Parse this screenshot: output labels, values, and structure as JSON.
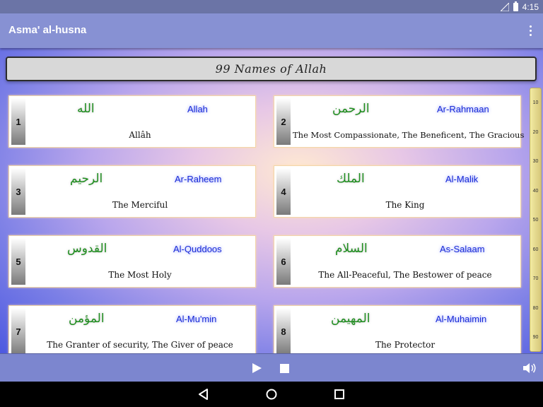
{
  "status_bar": {
    "time": "4:15",
    "icons": [
      "signal-icon",
      "battery-icon"
    ]
  },
  "app_bar": {
    "title": "Asma' al-husna",
    "menu_icon": "overflow-menu-icon"
  },
  "header": {
    "title": "99 Names of Allah"
  },
  "names": [
    {
      "number": "1",
      "arabic": "الله",
      "transliteration": "Allah",
      "meaning": "Allâh"
    },
    {
      "number": "2",
      "arabic": "الرحمن",
      "transliteration": "Ar-Rahmaan",
      "meaning": "The Most Compassionate, The Beneficent, The Gracious"
    },
    {
      "number": "3",
      "arabic": "الرحيم",
      "transliteration": "Ar-Raheem",
      "meaning": "The Merciful"
    },
    {
      "number": "4",
      "arabic": "الملك",
      "transliteration": "Al-Malik",
      "meaning": "The King"
    },
    {
      "number": "5",
      "arabic": "القدوس",
      "transliteration": "Al-Quddoos",
      "meaning": "The Most Holy"
    },
    {
      "number": "6",
      "arabic": "السلام",
      "transliteration": "As-Salaam",
      "meaning": "The All-Peaceful, The Bestower of peace"
    },
    {
      "number": "7",
      "arabic": "المؤمن",
      "transliteration": "Al-Mu'min",
      "meaning": "The Granter of security, The Giver of peace"
    },
    {
      "number": "8",
      "arabic": "المهيمن",
      "transliteration": "Al-Muhaimin",
      "meaning": "The Protector"
    }
  ],
  "index_scroller": {
    "labels": [
      "10",
      "20",
      "30",
      "40",
      "50",
      "60",
      "70",
      "80",
      "90"
    ]
  },
  "player": {
    "icons": [
      "play-icon",
      "stop-icon",
      "volume-icon"
    ]
  },
  "nav_bar": {
    "icons": [
      "back-icon",
      "home-icon",
      "recents-icon"
    ]
  }
}
